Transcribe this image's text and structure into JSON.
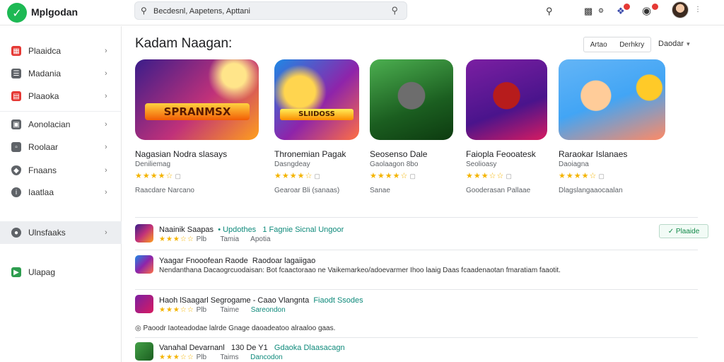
{
  "app": {
    "name": "Mplgodan"
  },
  "search": {
    "value": "Becdesnl, Aapetens, Apttani"
  },
  "sidebar": {
    "items": [
      {
        "label": "Plaaidca",
        "color": "#e53935",
        "icon": "grid-icon"
      },
      {
        "label": "Madania",
        "color": "#5f6368",
        "icon": "bars-icon"
      },
      {
        "label": "Plaaoka",
        "color": "#e53935",
        "icon": "book-icon"
      },
      {
        "label": "Aonolacian",
        "color": "#5f6368",
        "icon": "screen-icon"
      },
      {
        "label": "Roolaar",
        "color": "#5f6368",
        "icon": "window-icon"
      },
      {
        "label": "Fnaans",
        "color": "#5f6368",
        "icon": "shield-icon"
      },
      {
        "label": "Iaatlaa",
        "color": "#5f6368",
        "icon": "info-icon"
      },
      {
        "label": "Ulnsfaaks",
        "color": "#5f6368",
        "icon": "user-icon"
      },
      {
        "label": "Ulapag",
        "color": "#2e9d4f",
        "icon": "store-icon"
      }
    ]
  },
  "main": {
    "title": "Kadam Naagan:",
    "segments": [
      "Artao",
      "Derhkry"
    ],
    "sort_label": "Daodar"
  },
  "cards": [
    {
      "name": "Nagasian Nodra slasays",
      "developer": "Deniliemag",
      "stars": "★★★★☆",
      "rating": "▢",
      "meta": "Raacdare Narcano"
    },
    {
      "name": "Thronemian Pagak",
      "developer": "Dasngdeay",
      "stars": "★★★★☆",
      "rating": "▢",
      "meta": "Gearoar Bli (sanaas)"
    },
    {
      "name": "Seosenso Dale",
      "developer": "Gaolaagon 8bo",
      "stars": "★★★★☆",
      "rating": "▢",
      "meta": "Sanae"
    },
    {
      "name": "Faiopla Feooatesk",
      "developer": "Seolioasy",
      "stars": "★★★☆☆",
      "rating": "▢",
      "meta": "Gooderasan Pallaae"
    },
    {
      "name": "Raraokar Islanaes",
      "developer": "Daoiagna",
      "stars": "★★★★☆",
      "rating": "▢",
      "meta": "Dlagslangaaocaalan"
    }
  ],
  "list": [
    {
      "title": "Naainik Saapas",
      "extra": "• Updothes",
      "extra2": "1 Fagnie Sicnal Ungoor",
      "stars": "★★★☆☆",
      "sub": "Plb",
      "sub2": "Tamia",
      "sub3": "Apotia",
      "button": "Plaaide"
    },
    {
      "title": "Yaagar Fnooofean Raode",
      "extra2": "Raodoar lagaiigao",
      "desc": "Nendanthana Dacaogrcuodaisan: Bot fcaactoraao ne Vaikemarkeo/adoevarmer Ihoo laaig Daas fcaadenaotan fmaratiam faaotit."
    },
    {
      "title": "Haoh lSaagarl Segrogame - Caao Vlangnta",
      "extra2": "Fiaodt Ssodes",
      "stars": "★★★☆☆",
      "sub": "Plb",
      "sub2": "Taime",
      "sub3": "Sareondon"
    },
    {
      "note": "Paoodr Iaoteadodae lalrde Gnage daoadeatoo alraaloo gaas."
    },
    {
      "title": "Vanahal Devarnanl",
      "extra": "130 De Y1",
      "extra2": "Gdaoka Dlaasacagn",
      "stars": "★★★☆☆",
      "sub": "Plb",
      "sub2": "Taims",
      "sub3": "Dancodon"
    }
  ]
}
